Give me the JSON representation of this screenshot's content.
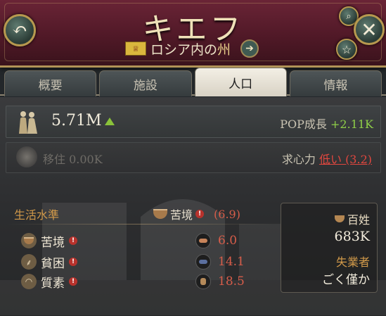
{
  "header": {
    "title": "キエフ",
    "subtitle_prefix": "ロシア内の",
    "subtitle_highlight": "州"
  },
  "tabs": [
    {
      "label": "概要",
      "active": false
    },
    {
      "label": "施設",
      "active": false
    },
    {
      "label": "人口",
      "active": true
    },
    {
      "label": "情報",
      "active": false
    }
  ],
  "population": {
    "value": "5.71M",
    "trend": "up",
    "growth_label": "POP成長",
    "growth_value": "+2.11K"
  },
  "migration": {
    "label": "移住",
    "value": "0.00K",
    "attract_label": "求心力",
    "attract_level": "低い",
    "attract_value": "(3.2)"
  },
  "living_standard": {
    "title": "生活水準",
    "status": "苦境",
    "status_value": "(6.9)",
    "rows": [
      {
        "label": "苦境",
        "value": "6.0"
      },
      {
        "label": "貧困",
        "value": "14.1"
      },
      {
        "label": "質素",
        "value": "18.5"
      }
    ]
  },
  "class_panel": {
    "class_label": "百姓",
    "class_value": "683K",
    "unemployed_label": "失業者",
    "unemployed_value": "ごく僅か"
  },
  "colors": {
    "header_bg": "#5a1c2c",
    "gold_trim": "#b19357",
    "positive": "#8fcf48",
    "negative": "#d75d4a",
    "accent_label": "#d29a4a"
  },
  "icons": [
    "back-arrow-icon",
    "search-icon",
    "close-icon",
    "star-icon",
    "flag-icon",
    "next-arrow-icon",
    "people-icon",
    "migration-icon",
    "bowl-icon",
    "wheat-icon",
    "hat-icon",
    "warning-icon"
  ]
}
